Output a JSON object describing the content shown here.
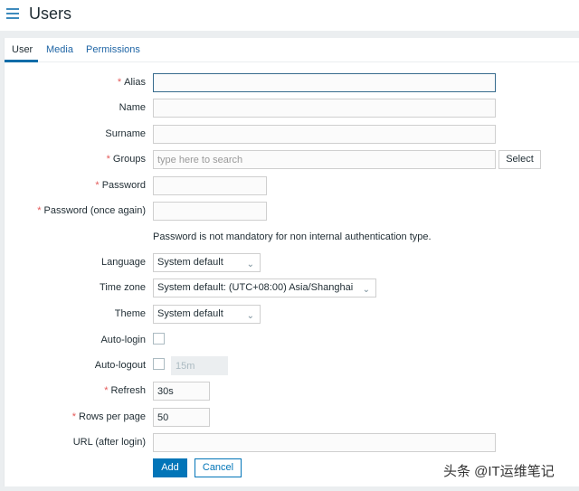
{
  "header": {
    "title": "Users",
    "menu_icon": "hamburger-menu-icon"
  },
  "tabs": [
    {
      "label": "User",
      "active": true
    },
    {
      "label": "Media",
      "active": false
    },
    {
      "label": "Permissions",
      "active": false
    }
  ],
  "form": {
    "alias": {
      "label": "Alias",
      "required": "*",
      "value": ""
    },
    "name": {
      "label": "Name",
      "value": ""
    },
    "surname": {
      "label": "Surname",
      "value": ""
    },
    "groups": {
      "label": "Groups",
      "required": "*",
      "placeholder": "type here to search",
      "select_label": "Select"
    },
    "password": {
      "label": "Password",
      "required": "*",
      "value": ""
    },
    "password_again": {
      "label": "Password (once again)",
      "required": "*",
      "value": ""
    },
    "password_hint": "Password is not mandatory for non internal authentication type.",
    "language": {
      "label": "Language",
      "selected": "System default"
    },
    "timezone": {
      "label": "Time zone",
      "selected": "System default: (UTC+08:00) Asia/Shanghai"
    },
    "theme": {
      "label": "Theme",
      "selected": "System default"
    },
    "auto_login": {
      "label": "Auto-login",
      "checked": false
    },
    "auto_logout": {
      "label": "Auto-logout",
      "checked": false,
      "value": "15m"
    },
    "refresh": {
      "label": "Refresh",
      "required": "*",
      "value": "30s"
    },
    "rows_per_page": {
      "label": "Rows per page",
      "required": "*",
      "value": "50"
    },
    "url": {
      "label": "URL (after login)",
      "value": ""
    },
    "add_label": "Add",
    "cancel_label": "Cancel"
  },
  "watermark": "头条 @IT运维笔记",
  "colors": {
    "accent": "#0275b8",
    "required": "#e45959",
    "link": "#1f65a5"
  }
}
